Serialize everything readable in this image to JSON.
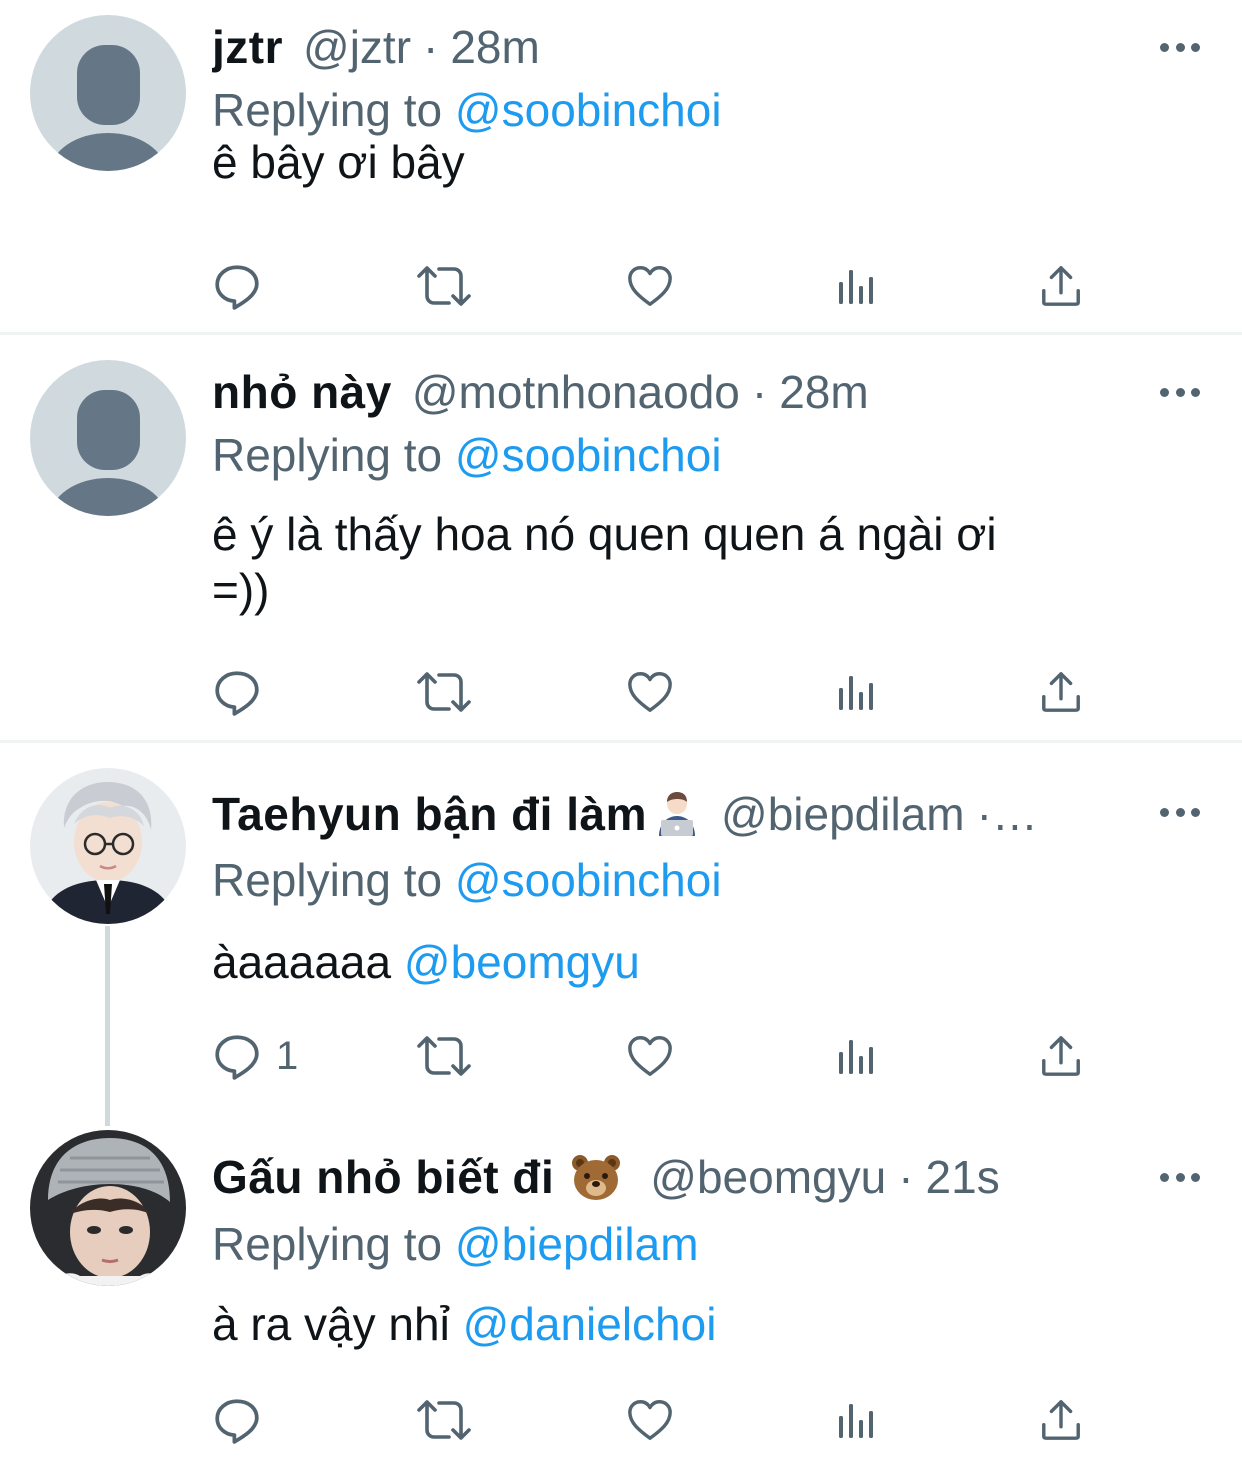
{
  "tweets": [
    {
      "name": "jztr",
      "handle": "@jztr",
      "separator": "·",
      "time": "28m",
      "replying_prefix": "Replying to",
      "replying_to": "@soobinchoi",
      "text_line1": "ê bây ơi bây",
      "text_line2": "",
      "mention": "",
      "reply_count": ""
    },
    {
      "name": "nhỏ này",
      "handle": "@motnhonaodo",
      "separator": "·",
      "time": "28m",
      "replying_prefix": "Replying to",
      "replying_to": "@soobinchoi",
      "text_line1": "ê ý là thấy hoa nó quen quen á ngài ơi",
      "text_line2": "=))",
      "mention": "",
      "reply_count": ""
    },
    {
      "name": "Taehyun bận đi làm",
      "handle": "@biepdilam",
      "separator": "·…",
      "time": "",
      "replying_prefix": "Replying to",
      "replying_to": "@soobinchoi",
      "text_line1": "àaaaaaa",
      "text_line2": "",
      "mention": "@beomgyu",
      "reply_count": "1"
    },
    {
      "name": "Gấu nhỏ biết đi",
      "handle": "@beomgyu",
      "separator": "·",
      "time": "21s",
      "replying_prefix": "Replying to",
      "replying_to": "@biepdilam",
      "text_line1": "à ra vậy nhỉ",
      "text_line2": "",
      "mention": "@danielchoi",
      "reply_count": ""
    }
  ],
  "colors": {
    "text": "#0f1419",
    "secondary": "#536471",
    "link": "#1d9bf0",
    "divider": "#eff3f4",
    "thread_line": "#cfd9de"
  },
  "icons": [
    "reply-icon",
    "retweet-icon",
    "like-icon",
    "analytics-icon",
    "share-icon",
    "more-icon",
    "man-technologist-emoji",
    "bear-emoji"
  ]
}
